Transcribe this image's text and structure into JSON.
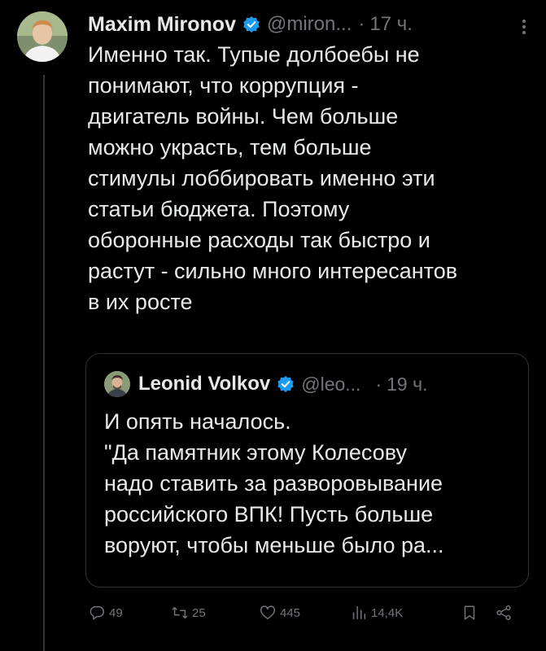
{
  "tweet": {
    "author_name": "Maxim Mironov",
    "handle": "@miron...",
    "separator": "·",
    "time": "17 ч.",
    "text_lines": [
      "Именно так. Тупые долбоебы не",
      "понимают, что коррупция -",
      "двигатель войны. Чем больше",
      "можно украсть, тем больше",
      "стимулы лоббировать именно эти",
      "статьи бюджета. Поэтому",
      "оборонные расходы так быстро и",
      "растут - сильно много интересантов",
      "в их росте"
    ]
  },
  "quote": {
    "author_name": "Leonid Volkov",
    "handle": "@leo...",
    "separator": "·",
    "time": "19 ч.",
    "text_lines": [
      "И опять началось.",
      "\"Да памятник этому Колесову",
      "надо ставить за разворовывание",
      "российского ВПК! Пусть больше",
      "воруют, чтобы меньше было ра..."
    ]
  },
  "actions": {
    "replies": "49",
    "retweets": "25",
    "likes": "445",
    "views": "14,4K"
  },
  "colors": {
    "background": "#000000",
    "text": "#e7e9ea",
    "muted": "#71767b",
    "border": "#2f3336",
    "verified": "#1d9bf0"
  },
  "icons": {
    "verified": "verified-badge-icon",
    "more": "more-dots-icon",
    "reply": "reply-icon",
    "retweet": "retweet-icon",
    "like": "heart-icon",
    "views": "views-bars-icon",
    "bookmark": "bookmark-icon",
    "share": "share-icon"
  }
}
